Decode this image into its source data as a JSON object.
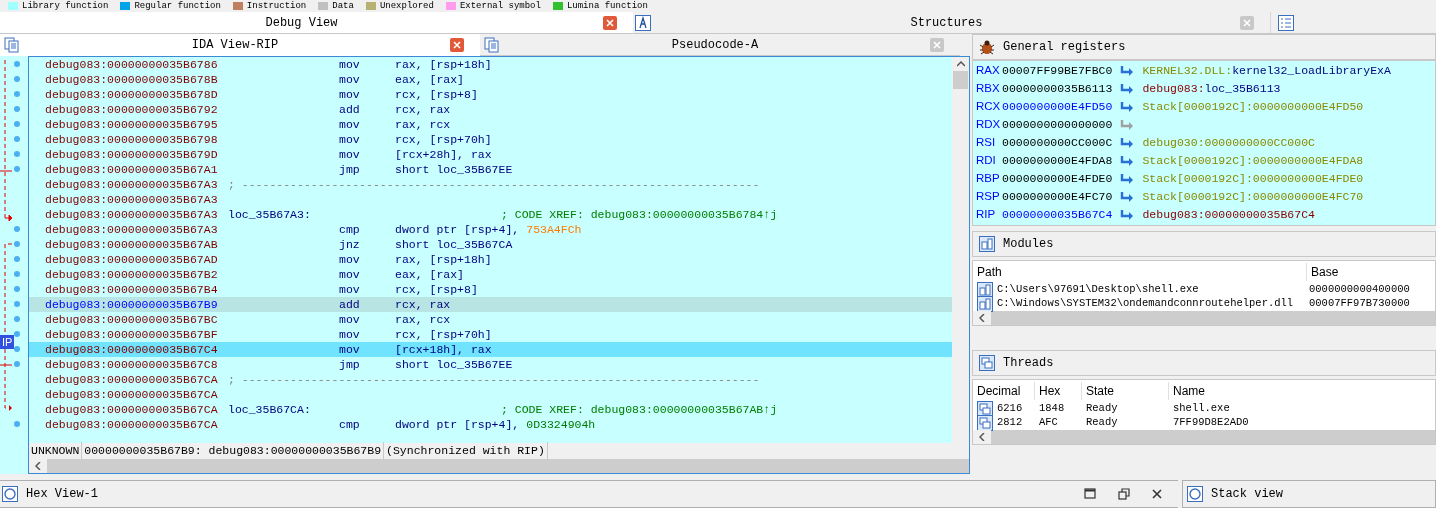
{
  "legend": [
    {
      "label": "Library function",
      "color": "#a0ffff"
    },
    {
      "label": "Regular function",
      "color": "#00a2e8"
    },
    {
      "label": "Instruction",
      "color": "#c08060"
    },
    {
      "label": "Data",
      "color": "#c0c0c0"
    },
    {
      "label": "Unexplored",
      "color": "#b8b070"
    },
    {
      "label": "External symbol",
      "color": "#ff9cf0"
    },
    {
      "label": "Lumina function",
      "color": "#30c030"
    }
  ],
  "top_tabs": [
    {
      "title": "Debug View",
      "selected": true
    },
    {
      "title": "Structures",
      "selected": false
    }
  ],
  "view_tabs": [
    {
      "title": "IDA View-RIP",
      "selected": true
    },
    {
      "title": "Pseudocode-A",
      "selected": false
    }
  ],
  "listing": {
    "ip_marker": "IP",
    "lines": [
      {
        "kind": "instr",
        "address": "debug083:00000000035B6786",
        "mnemonic": "mov",
        "operands": "rax, [rsp+18h]",
        "selected": false,
        "current": false
      },
      {
        "kind": "instr",
        "address": "debug083:00000000035B678B",
        "mnemonic": "mov",
        "operands": "eax, [rax]",
        "selected": false,
        "current": false
      },
      {
        "kind": "instr",
        "address": "debug083:00000000035B678D",
        "mnemonic": "mov",
        "operands": "rcx, [rsp+8]",
        "selected": false,
        "current": false
      },
      {
        "kind": "instr",
        "address": "debug083:00000000035B6792",
        "mnemonic": "add",
        "operands": "rcx, rax",
        "selected": false,
        "current": false
      },
      {
        "kind": "instr",
        "address": "debug083:00000000035B6795",
        "mnemonic": "mov",
        "operands": "rax, rcx",
        "selected": false,
        "current": false
      },
      {
        "kind": "instr",
        "address": "debug083:00000000035B6798",
        "mnemonic": "mov",
        "operands": "rcx, [rsp+70h]",
        "selected": false,
        "current": false
      },
      {
        "kind": "instr",
        "address": "debug083:00000000035B679D",
        "mnemonic": "mov",
        "operands": "[rcx+28h], rax",
        "selected": false,
        "current": false
      },
      {
        "kind": "instr",
        "address": "debug083:00000000035B67A1",
        "mnemonic": "jmp",
        "operands": "short loc_35B67EE",
        "selected": false,
        "current": false
      },
      {
        "kind": "separator",
        "address": "debug083:00000000035B67A3",
        "text": "; ---------------------------------------------------------------------------",
        "selected": false,
        "current": false
      },
      {
        "kind": "blank",
        "address": "debug083:00000000035B67A3",
        "selected": false,
        "current": false
      },
      {
        "kind": "label",
        "address": "debug083:00000000035B67A3",
        "label": "loc_35B67A3:",
        "comment": "; CODE XREF: debug083:00000000035B6784↑j",
        "selected": false,
        "current": false
      },
      {
        "kind": "instr",
        "address": "debug083:00000000035B67A3",
        "mnemonic": "cmp",
        "operands": "dword ptr [rsp+4],",
        "constant": {
          "text": "753A4FCh",
          "kind": "data"
        },
        "selected": false,
        "current": false
      },
      {
        "kind": "instr",
        "address": "debug083:00000000035B67AB",
        "mnemonic": "jnz",
        "operands": "short loc_35B67CA",
        "selected": false,
        "current": false
      },
      {
        "kind": "instr",
        "address": "debug083:00000000035B67AD",
        "mnemonic": "mov",
        "operands": "rax, [rsp+18h]",
        "selected": false,
        "current": false
      },
      {
        "kind": "instr",
        "address": "debug083:00000000035B67B2",
        "mnemonic": "mov",
        "operands": "eax, [rax]",
        "selected": false,
        "current": false
      },
      {
        "kind": "instr",
        "address": "debug083:00000000035B67B4",
        "mnemonic": "mov",
        "operands": "rcx, [rsp+8]",
        "selected": false,
        "current": false
      },
      {
        "kind": "instr",
        "address": "debug083:00000000035B67B9",
        "mnemonic": "add",
        "operands": "rcx, rax",
        "selected": true,
        "current": false
      },
      {
        "kind": "instr",
        "address": "debug083:00000000035B67BC",
        "mnemonic": "mov",
        "operands": "rax, rcx",
        "selected": false,
        "current": false
      },
      {
        "kind": "instr",
        "address": "debug083:00000000035B67BF",
        "mnemonic": "mov",
        "operands": "rcx, [rsp+70h]",
        "selected": false,
        "current": false
      },
      {
        "kind": "instr",
        "address": "debug083:00000000035B67C4",
        "mnemonic": "mov",
        "operands": "[rcx+18h], rax",
        "selected": false,
        "current": true
      },
      {
        "kind": "instr",
        "address": "debug083:00000000035B67C8",
        "mnemonic": "jmp",
        "operands": "short loc_35B67EE",
        "selected": false,
        "current": false
      },
      {
        "kind": "separator",
        "address": "debug083:00000000035B67CA",
        "text": "; ---------------------------------------------------------------------------",
        "selected": false,
        "current": false
      },
      {
        "kind": "blank",
        "address": "debug083:00000000035B67CA",
        "selected": false,
        "current": false
      },
      {
        "kind": "label",
        "address": "debug083:00000000035B67CA",
        "label": "loc_35B67CA:",
        "comment": "; CODE XREF: debug083:00000000035B67AB↑j",
        "selected": false,
        "current": false
      },
      {
        "kind": "instr",
        "address": "debug083:00000000035B67CA",
        "mnemonic": "cmp",
        "operands": "dword ptr [rsp+4],",
        "constant": {
          "text": "0D3324904h",
          "kind": "number"
        },
        "selected": false,
        "current": false
      }
    ],
    "status": [
      "UNKNOWN",
      "00000000035B67B9: debug083:00000000035B67B9",
      "(Synchronized with RIP)"
    ]
  },
  "registers": {
    "title": "General registers",
    "rows": [
      {
        "name": "RAX",
        "value": "00007FF99BE7FBC0",
        "changed": false,
        "target": {
          "segment": "KERNEL32.DLL:",
          "name": "kernel32_LoadLibraryExA",
          "kind": "library"
        }
      },
      {
        "name": "RBX",
        "value": "00000000035B6113",
        "changed": false,
        "target": {
          "segment": "debug083:",
          "name": "loc_35B6113",
          "kind": "code"
        }
      },
      {
        "name": "RCX",
        "value": "0000000000E4FD50",
        "changed": true,
        "target": {
          "segment": "Stack[0000192C]:0000000000E4FD50",
          "kind": "data"
        }
      },
      {
        "name": "RDX",
        "value": "0000000000000000",
        "changed": false
      },
      {
        "name": "RSI",
        "value": "0000000000CC000C",
        "changed": false,
        "target": {
          "segment": "debug030:0000000000CC000C",
          "kind": "data"
        }
      },
      {
        "name": "RDI",
        "value": "0000000000E4FDA8",
        "changed": false,
        "target": {
          "segment": "Stack[0000192C]:0000000000E4FDA8",
          "kind": "data"
        }
      },
      {
        "name": "RBP",
        "value": "0000000000E4FDE0",
        "changed": false,
        "target": {
          "segment": "Stack[0000192C]:0000000000E4FDE0",
          "kind": "data"
        }
      },
      {
        "name": "RSP",
        "value": "0000000000E4FC70",
        "changed": false,
        "target": {
          "segment": "Stack[0000192C]:0000000000E4FC70",
          "kind": "data"
        }
      },
      {
        "name": "RIP",
        "value": "00000000035B67C4",
        "changed": true,
        "target": {
          "segment": "debug083:00000000035B67C4",
          "kind": "code"
        }
      }
    ]
  },
  "modules": {
    "title": "Modules",
    "columns": [
      "Path",
      "Base"
    ],
    "rows": [
      [
        "C:\\Users\\97691\\Desktop\\shell.exe",
        "0000000000400000"
      ],
      [
        "C:\\Windows\\SYSTEM32\\ondemandconnroutehelper.dll",
        "00007FF97B730000"
      ]
    ]
  },
  "threads": {
    "title": "Threads",
    "columns": [
      "Decimal",
      "Hex",
      "State",
      "Name"
    ],
    "rows": [
      [
        "6216",
        "1848",
        "Ready",
        "shell.exe"
      ],
      [
        "2812",
        "AFC",
        "Ready",
        "7FF99D8E2AD0"
      ]
    ]
  },
  "bottom_panels": [
    {
      "title": "Hex View-1"
    },
    {
      "title": "Stack view"
    }
  ]
}
